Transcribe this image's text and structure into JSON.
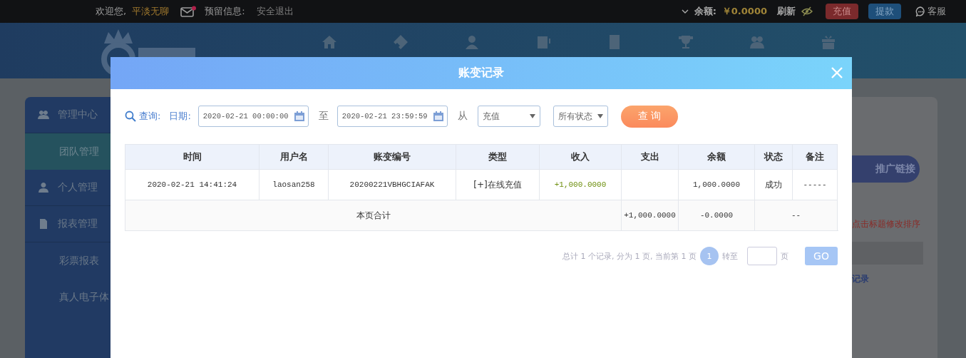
{
  "top_bar": {
    "welcome": "欢迎您,",
    "username": "平淡无聊",
    "message_unread": true,
    "notice_label": "预留信息:",
    "logout": "安全退出",
    "balance_label": "余额:",
    "balance": "￥0.0000",
    "refresh": "刷新",
    "deposit": "充值",
    "withdraw": "提款",
    "service": "客服"
  },
  "sidebar": {
    "items": [
      {
        "label": "管理中心",
        "kind": "group",
        "selected": false
      },
      {
        "label": "团队管理",
        "kind": "item",
        "selected": true
      },
      {
        "label": "个人管理",
        "kind": "group",
        "selected": false
      },
      {
        "label": "报表管理",
        "kind": "group",
        "selected": false
      },
      {
        "label": "彩票报表",
        "kind": "item",
        "selected": false
      },
      {
        "label": "真人电子体",
        "kind": "item",
        "selected": false
      }
    ]
  },
  "side_panel": {
    "promo_button": "推广链接",
    "hint": "点击标题修改排序",
    "row_link": "记录"
  },
  "dialog": {
    "title": "账变记录",
    "query_label": "查询:",
    "date_label": "日期:",
    "start": "2020-02-21 00:00:00",
    "to": "至",
    "end": "2020-02-21 23:59:59",
    "from": "从",
    "type_select": "充值",
    "status_select": "所有状态",
    "search_button": "查 询",
    "table": {
      "columns": [
        "时间",
        "用户名",
        "账变编号",
        "类型",
        "收入",
        "支出",
        "余额",
        "状态",
        "备注"
      ],
      "rows": [
        {
          "cells": [
            "2020-02-21 14:41:24",
            "laosan258",
            "20200221VBHGCIAFAK",
            "[+]在线充值",
            "+1,000.0000",
            "",
            "1,000.0000",
            "成功",
            "-----"
          ]
        }
      ],
      "total": {
        "label": "本页合计",
        "income": "+1,000.0000",
        "expense": "-0.0000",
        "rest": "--"
      }
    },
    "pagination": {
      "summary": "总计 1 个记录, 分为 1 页, 当前第 1 页",
      "pages": [
        {
          "label": "1",
          "selected": true
        }
      ],
      "goto": "转至",
      "page_unit": "页",
      "go": "GO"
    }
  }
}
